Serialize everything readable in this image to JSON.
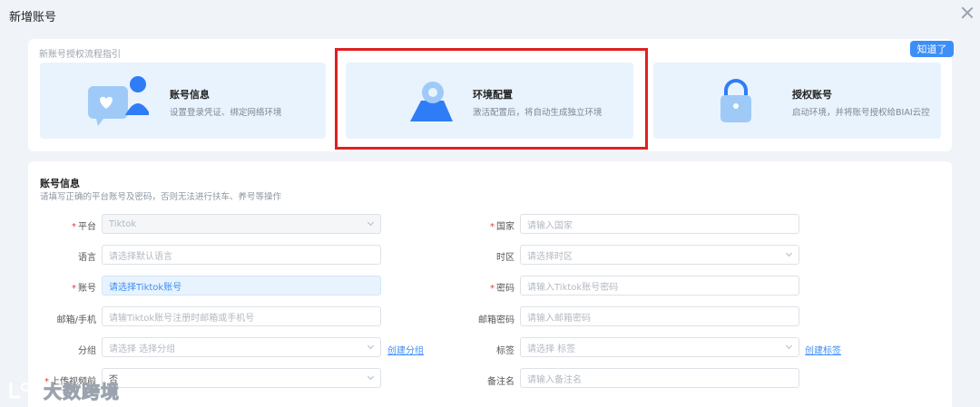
{
  "dialog": {
    "title": "新增账号"
  },
  "guide": {
    "title": "新账号授权流程指引",
    "know_button": "知道了",
    "steps": [
      {
        "title": "账号信息",
        "desc": "设置登录凭证、绑定网络环境"
      },
      {
        "title": "环境配置",
        "desc": "激活配置后，将自动生成独立环境"
      },
      {
        "title": "授权账号",
        "desc": "启动环境，并将账号授权给BIAI云控"
      }
    ]
  },
  "form": {
    "title": "账号信息",
    "subtitle": "请填写正确的平台账号及密码，否则无法进行扶车、养号等操作",
    "platform": {
      "label": "平台",
      "value": "Tiktok"
    },
    "language": {
      "label": "语言",
      "placeholder": "请选择默认语言"
    },
    "account": {
      "label": "账号",
      "value": "请选择Tiktok账号"
    },
    "email": {
      "label": "邮箱/手机",
      "placeholder": "请输Tiktok账号注册时邮箱或手机号"
    },
    "group": {
      "label": "分组",
      "placeholder": "请选择 选择分组",
      "link": "创建分组"
    },
    "upload": {
      "label": "上传视频前",
      "value": "否"
    },
    "country": {
      "label": "国家",
      "placeholder": "请输入国家"
    },
    "timezone": {
      "label": "时区",
      "placeholder": "请选择时区"
    },
    "password": {
      "label": "密码",
      "placeholder": "请输入Tiktok账号密码"
    },
    "email_password": {
      "label": "邮箱密码",
      "placeholder": "请输入邮箱密码"
    },
    "tags": {
      "label": "标签",
      "placeholder": "请选择 标签",
      "link": "创建标签"
    },
    "remark": {
      "label": "备注名",
      "placeholder": "请输入备注名"
    }
  },
  "watermark": {
    "text": "大数跨境"
  },
  "colors": {
    "accent": "#3d8ef8",
    "highlight": "#e02020",
    "required": "#e4393c"
  }
}
